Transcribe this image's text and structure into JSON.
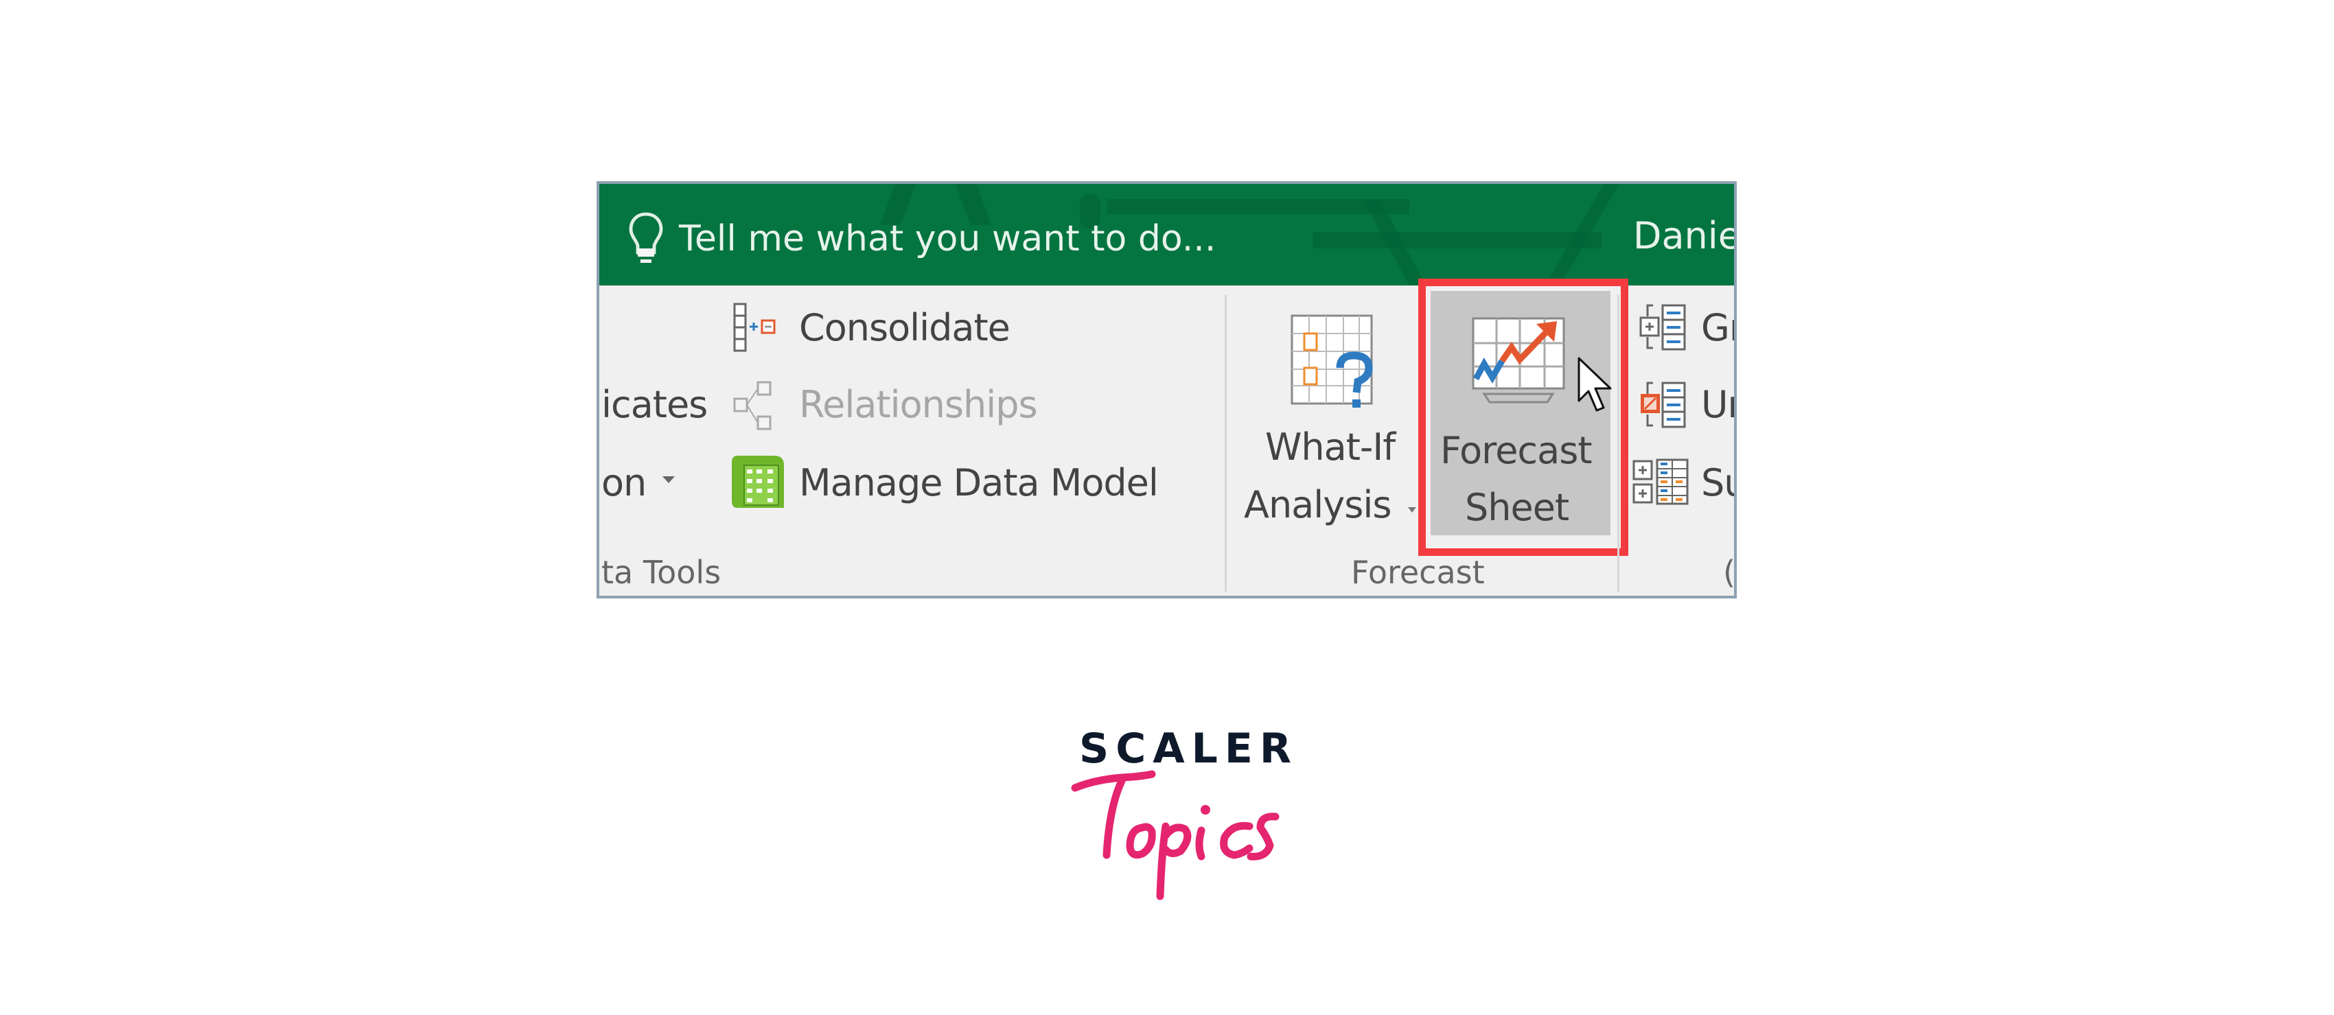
{
  "tell_me": {
    "placeholder": "Tell me what you want to do...",
    "icon": "lightbulb-icon"
  },
  "user_name": "Danie",
  "ribbon": {
    "data_tools": {
      "partial_items": [
        "icates",
        "on"
      ],
      "items": [
        {
          "label": "Consolidate",
          "icon": "consolidate-icon",
          "enabled": true
        },
        {
          "label": "Relationships",
          "icon": "relationships-icon",
          "enabled": false
        },
        {
          "label": "Manage Data Model",
          "icon": "manage-data-model-icon",
          "enabled": true
        }
      ],
      "group_label": "ta Tools"
    },
    "forecast": {
      "what_if": {
        "line1": "What-If",
        "line2": "Analysis",
        "icon": "what-if-analysis-icon"
      },
      "forecast_sheet": {
        "line1": "Forecast",
        "line2": "Sheet",
        "icon": "forecast-sheet-icon",
        "highlighted": true
      },
      "group_label": "Forecast"
    },
    "outline": {
      "items": [
        {
          "label": "Gr",
          "icon": "group-icon"
        },
        {
          "label": "Un",
          "icon": "ungroup-icon"
        },
        {
          "label": "Su",
          "icon": "subtotal-icon"
        }
      ],
      "group_label": "("
    }
  },
  "annotation": {
    "color": "#f43b3f",
    "target": "Forecast Sheet"
  },
  "branding": {
    "line1": "SCALER",
    "line2": "Topics",
    "line1_color": "#0e1a2b",
    "line2_color": "#e5256f"
  }
}
